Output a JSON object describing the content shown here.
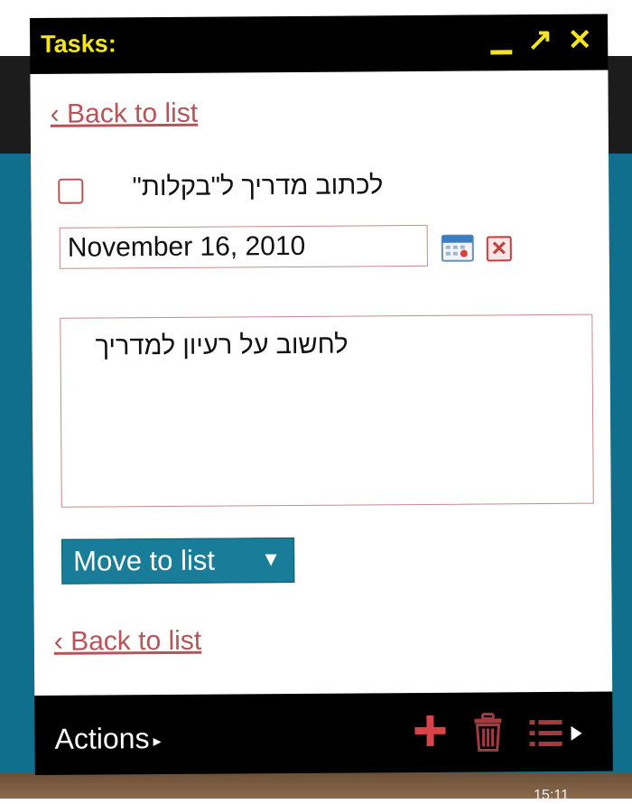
{
  "window": {
    "title": "Tasks:",
    "controls": {
      "minimize": "minimize-icon",
      "maximize": "expand-icon",
      "close": "close-icon"
    }
  },
  "nav": {
    "back_label": "‹ Back to list"
  },
  "task": {
    "title": "לכתוב מדריך ל\"בקלות\"",
    "completed": false,
    "due_date": "November 16, 2010",
    "notes": "לחשוב על רעיון למדריך"
  },
  "move": {
    "label": "Move to list",
    "caret": "▼"
  },
  "footer": {
    "actions_label": "Actions",
    "actions_caret": "▸",
    "list_caret": "▸"
  },
  "taskbar": {
    "clock": "15:11"
  },
  "colors": {
    "accent": "#f5e51c",
    "link": "#b5555a",
    "button": "#197d99",
    "background": "#0f6f8c"
  }
}
